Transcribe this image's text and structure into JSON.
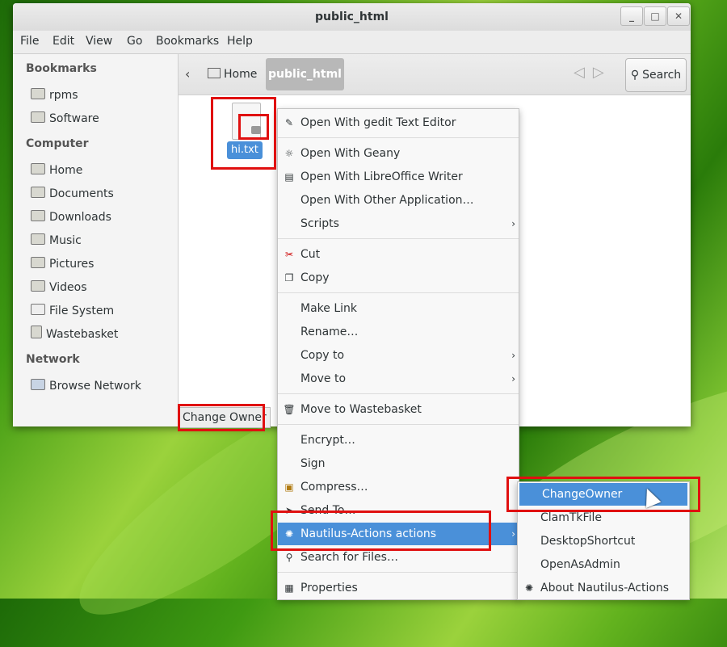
{
  "window": {
    "title": "public_html",
    "controls": {
      "minimize": "_",
      "maximize": "□",
      "close": "✕"
    }
  },
  "menubar": [
    "File",
    "Edit",
    "View",
    "Go",
    "Bookmarks",
    "Help"
  ],
  "sidebar": {
    "bookmarks_heading": "Bookmarks",
    "bookmarks": [
      "rpms",
      "Software"
    ],
    "computer_heading": "Computer",
    "computer": [
      "Home",
      "Documents",
      "Downloads",
      "Music",
      "Pictures",
      "Videos",
      "File System",
      "Wastebasket"
    ],
    "network_heading": "Network",
    "network": [
      "Browse Network"
    ]
  },
  "pathbar": {
    "back_glyph": "‹",
    "home_label": "Home",
    "current": "public_html",
    "search_label": "Search"
  },
  "files": [
    {
      "name": "hi.txt"
    }
  ],
  "statusbar": "Change Owner",
  "context_menu": {
    "items": [
      {
        "label": "Open With gedit Text Editor",
        "icon": "gedit-icon"
      },
      {
        "label": "Open With Geany",
        "icon": "geany-icon"
      },
      {
        "label": "Open With LibreOffice Writer",
        "icon": "writer-icon"
      },
      {
        "label": "Open With Other Application…",
        "icon": ""
      },
      {
        "label": "Scripts",
        "icon": "",
        "submenu": true
      },
      {
        "label": "Cut",
        "icon": "scissors-icon"
      },
      {
        "label": "Copy",
        "icon": "copy-icon"
      },
      {
        "label": "Make Link",
        "icon": ""
      },
      {
        "label": "Rename…",
        "icon": ""
      },
      {
        "label": "Copy to",
        "icon": "",
        "submenu": true
      },
      {
        "label": "Move to",
        "icon": "",
        "submenu": true
      },
      {
        "label": "Move to Wastebasket",
        "icon": "trash-icon"
      },
      {
        "label": "Encrypt…",
        "icon": ""
      },
      {
        "label": "Sign",
        "icon": ""
      },
      {
        "label": "Compress…",
        "icon": "archive-icon"
      },
      {
        "label": "Send To…",
        "icon": "send-icon"
      },
      {
        "label": "Nautilus-Actions actions",
        "icon": "nautilus-actions-icon",
        "submenu": true,
        "highlighted": true
      },
      {
        "label": "Search for Files…",
        "icon": "search-icon"
      },
      {
        "label": "Properties",
        "icon": "properties-icon"
      }
    ]
  },
  "submenu": {
    "items": [
      {
        "label": "ChangeOwner",
        "highlighted": true
      },
      {
        "label": "ClamTkFile"
      },
      {
        "label": "DesktopShortcut"
      },
      {
        "label": "OpenAsAdmin"
      },
      {
        "label": "About Nautilus-Actions",
        "icon": "nautilus-actions-icon"
      }
    ]
  },
  "colors": {
    "selection": "#4a90d9",
    "annotation": "#e01010"
  }
}
